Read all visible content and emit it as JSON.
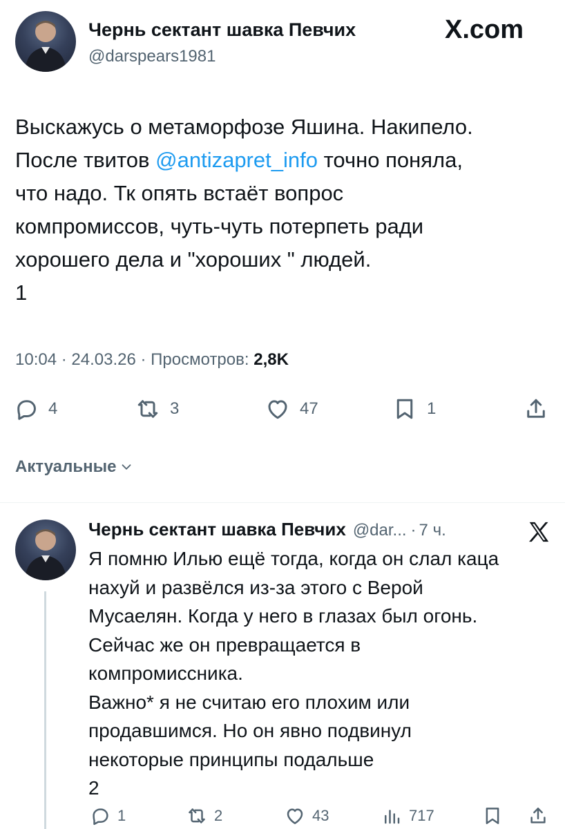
{
  "header": {
    "name": "Чернь сектант шавка Певчих",
    "handle": "@darspears1981",
    "brand": "X.com"
  },
  "tweet": {
    "lines": [
      "Выскажусь о метаморфозе Яшина. Накипело.",
      "После твитов ",
      "что надо. Тк опять встаёт вопрос",
      "компромиссов, чуть-чуть потерпеть ради",
      "хорошего дела и \"хороших \" людей.",
      "1"
    ],
    "mention": "@antizapret_info",
    "line2_tail": " точно поняла,",
    "time": "10:04",
    "sep": "·",
    "date": "24.03.26",
    "views_label": "Просмотров:",
    "views_count": "2,8K"
  },
  "actions": {
    "replies": "4",
    "retweets": "3",
    "likes": "47",
    "bookmarks": "1"
  },
  "sort": {
    "label": "Актуальные"
  },
  "reply": {
    "name": "Чернь сектант шавка Певчих",
    "handle": "@dar...",
    "sep": "·",
    "time": "7 ч.",
    "lines": [
      "Я помню Илью ещё тогда, когда он слал каца",
      "нахуй и развёлся из-за этого с Верой",
      "Мусаелян. Когда у него в глазах был огонь.",
      "Сейчас же он превращается в",
      "компромиссника.",
      "Важно* я не считаю его плохим или",
      "продавшимся. Но он явно подвинул",
      "некоторые принципы подальше",
      "2"
    ],
    "actions": {
      "replies": "1",
      "retweets": "2",
      "likes": "43",
      "views": "717"
    }
  },
  "colors": {
    "accent": "#1d9bf0",
    "text": "#0f1419",
    "muted": "#536471",
    "divider": "#eff3f4"
  }
}
